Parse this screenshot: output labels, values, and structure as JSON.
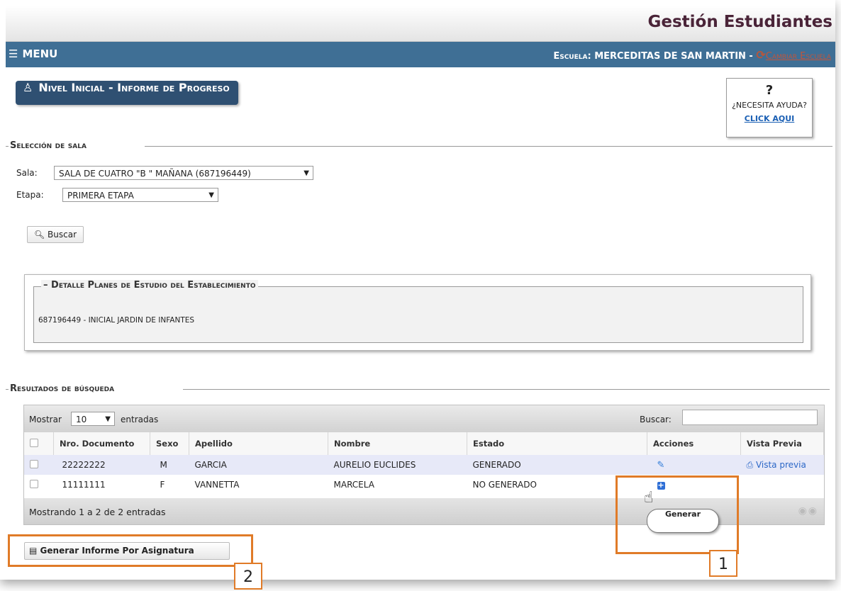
{
  "app": {
    "title": "Gestión Estudiantes"
  },
  "menubar": {
    "menu_label": "MENU",
    "school_prefix": "Escuela:",
    "school_name": "MERCEDITAS DE SAN MARTIN -",
    "change_school": "Cambiar Escuela"
  },
  "page": {
    "title": "Nivel Inicial - Informe de Progreso"
  },
  "help": {
    "question": "?",
    "text": "¿Necesita Ayuda?",
    "link": "CLICK AQUI"
  },
  "seleccion": {
    "legend": "Selección de sala",
    "sala_label": "Sala:",
    "sala_value": "SALA DE CUATRO \"B \" MAÑANA (687196449)",
    "etapa_label": "Etapa:",
    "etapa_value": "PRIMERA ETAPA",
    "buscar_button": "Buscar"
  },
  "detalle": {
    "legend": "Detalle Planes de Estudio del Establecimiento",
    "text": "687196449 - INICIAL JARDIN DE INFANTES"
  },
  "resultados": {
    "legend": "Resultados de búsqueda",
    "mostrar_label": "Mostrar",
    "page_length": "10",
    "entradas_label": "entradas",
    "search_label": "Buscar:",
    "columns": [
      "Nro. Documento",
      "Sexo",
      "Apellido",
      "Nombre",
      "Estado",
      "Acciones",
      "Vista Previa"
    ],
    "rows": [
      {
        "doc": "22222222",
        "sexo": "M",
        "apellido": "GARCIA",
        "nombre": "AURELIO EUCLIDES",
        "estado": "GENERADO",
        "vista": "Vista previa"
      },
      {
        "doc": "11111111",
        "sexo": "F",
        "apellido": "VANNETTA",
        "nombre": "MARCELA",
        "estado": "NO GENERADO",
        "vista": ""
      }
    ],
    "footer_info": "Mostrando 1 a 2 de 2 entradas",
    "tooltip": "Generar"
  },
  "generar_button": "Generar Informe Por Asignatura",
  "callouts": {
    "one": "1",
    "two": "2"
  },
  "colors": {
    "header_blue": "#3f6f95",
    "title_dark": "#2f5072",
    "callout_orange": "#e07b28"
  }
}
